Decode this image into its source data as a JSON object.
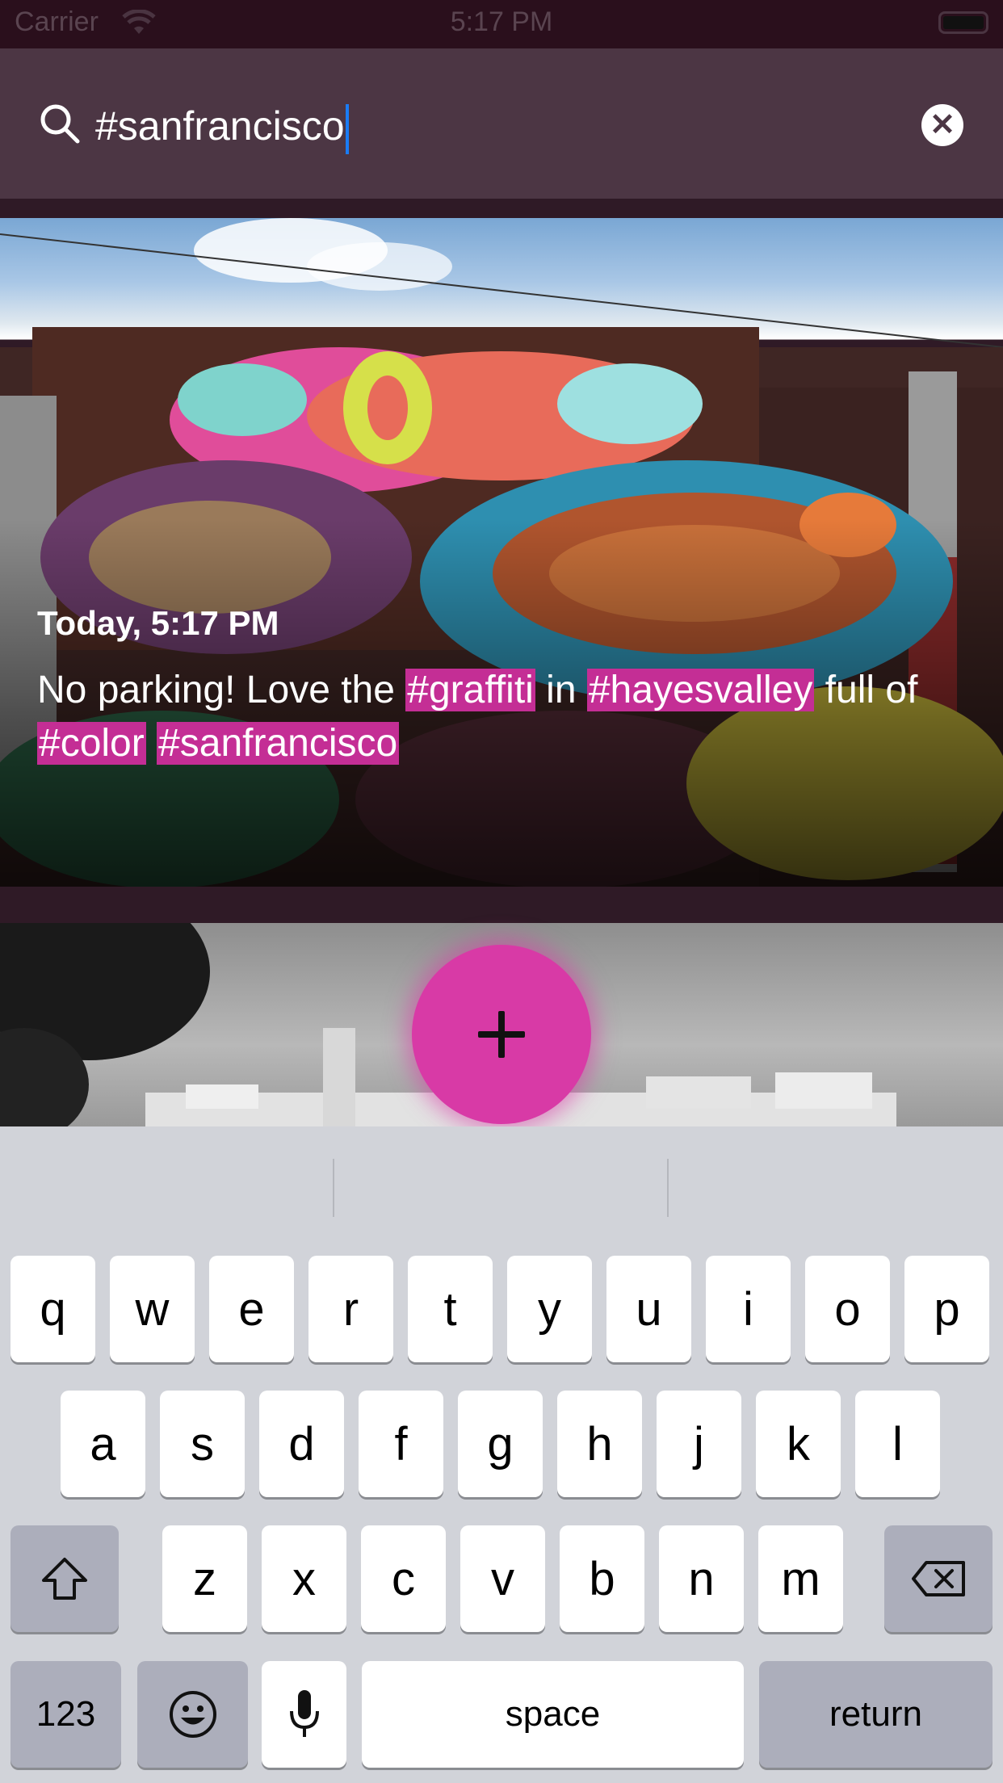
{
  "status_bar": {
    "carrier": "Carrier",
    "time": "5:17 PM"
  },
  "search": {
    "query": "#sanfrancisco",
    "clear_icon": "close-icon"
  },
  "post": {
    "date": "Today, 5:17 PM",
    "caption_parts": {
      "p1": "No parking! Love the ",
      "tag1": "#graffiti",
      "p2": " in ",
      "tag2": "#hayesvalley",
      "p3": " full of ",
      "tag3": "#color",
      "p4": " ",
      "tag4": "#sanfrancisco"
    },
    "tag_color": "#c42e95"
  },
  "fab": {
    "icon": "plus-icon",
    "color": "#d83aa6"
  },
  "keyboard": {
    "row1": [
      "q",
      "w",
      "e",
      "r",
      "t",
      "y",
      "u",
      "i",
      "o",
      "p"
    ],
    "row2": [
      "a",
      "s",
      "d",
      "f",
      "g",
      "h",
      "j",
      "k",
      "l"
    ],
    "row3": [
      "z",
      "x",
      "c",
      "v",
      "b",
      "n",
      "m"
    ],
    "numbers_label": "123",
    "space_label": "space",
    "return_label": "return"
  }
}
